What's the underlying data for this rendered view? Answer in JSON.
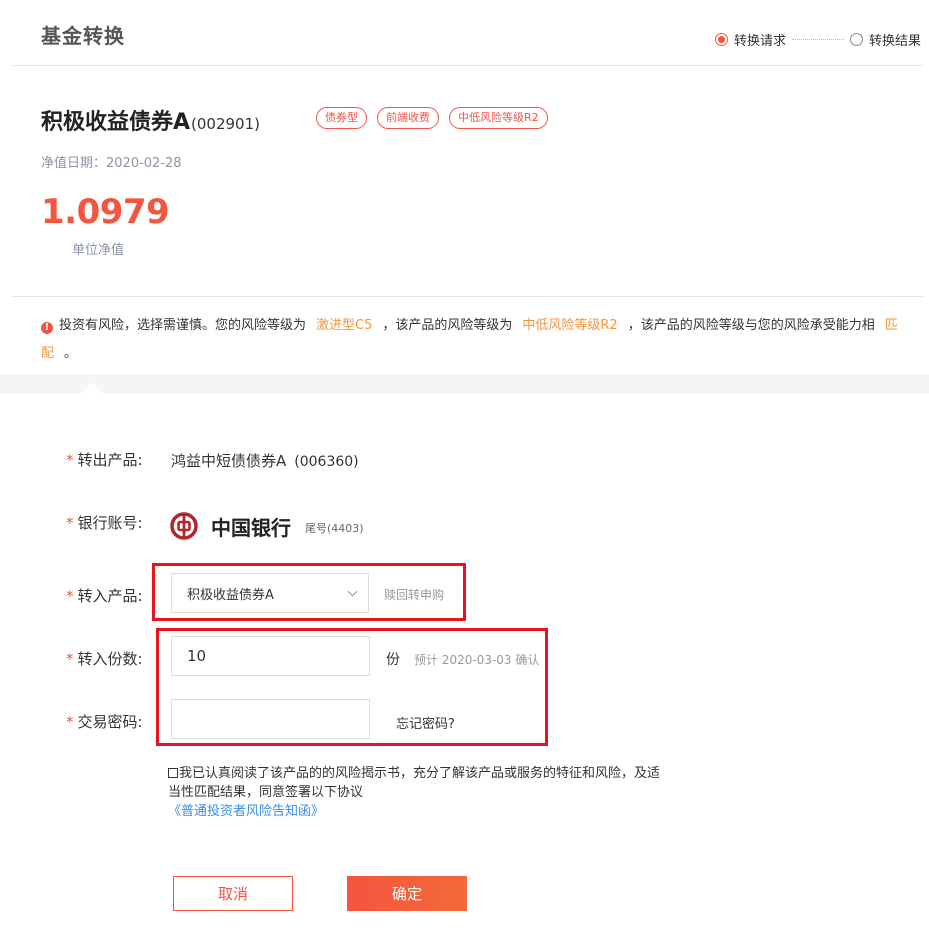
{
  "header": {
    "title": "基金转换",
    "steps": [
      {
        "label": "转换请求",
        "active": true
      },
      {
        "label": "转换结果",
        "active": false
      }
    ]
  },
  "fund": {
    "name": "积极收益债券A",
    "code": "(002901)",
    "tags": [
      "债券型",
      "前端收费",
      "中低风险等级R2"
    ],
    "nav_date": "净值日期：2020-02-28",
    "nav_value": "1.0979",
    "nav_label": "单位净值"
  },
  "risk_notice": {
    "part1": "投资有风险，选择需谨慎。您的风险等级为",
    "user_level": "激进型C5",
    "part2": "，该产品的风险等级为",
    "product_level": "中低风险等级R2",
    "part3": "，该产品的风险等级与您的风险承受能力相",
    "match": "匹配",
    "part4": "。"
  },
  "form": {
    "required_mark": "*",
    "out_product": {
      "label": "转出产品:",
      "name": "鸿益中短债债券A",
      "code": "(006360)"
    },
    "bank": {
      "label": "银行账号:",
      "name": "中国银行",
      "tail": "尾号(4403)"
    },
    "in_product": {
      "label": "转入产品:",
      "selected": "积极收益债券A",
      "note": "赎回转申购"
    },
    "shares": {
      "label": "转入份数:",
      "value": "10",
      "unit": "份",
      "estimate": "预计 2020-03-03 确认"
    },
    "password": {
      "label": "交易密码:",
      "value": "",
      "forgot": "忘记密码?"
    },
    "agreement": {
      "text": "我已认真阅读了该产品的的风险揭示书，充分了解该产品或服务的特征和风险，及适当性匹配结果，同意签署以下协议",
      "link": "《普通投资者风险告知函》"
    }
  },
  "buttons": {
    "cancel": "取消",
    "confirm": "确定"
  },
  "colors": {
    "accent": "#f5543e",
    "highlight": "#f5963a",
    "link": "#3a8ee6",
    "annotation": "#e8141d"
  }
}
